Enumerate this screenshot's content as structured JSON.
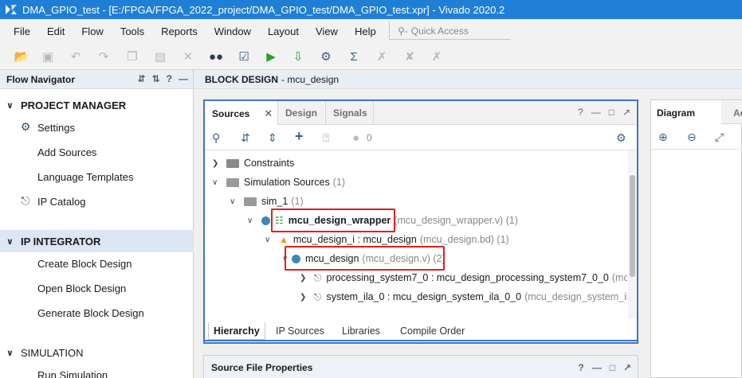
{
  "window": {
    "title": "DMA_GPIO_test - [E:/FPGA/FPGA_2022_project/DMA_GPIO_test/DMA_GPIO_test.xpr] - Vivado 2020.2",
    "accent": "#1f7fd6"
  },
  "menu": {
    "items": [
      "File",
      "Edit",
      "Flow",
      "Tools",
      "Reports",
      "Window",
      "Layout",
      "View",
      "Help"
    ],
    "quick_access": "Quick Access"
  },
  "toolbar": {
    "icons": [
      "open-project-icon",
      "save-icon",
      "undo-icon",
      "redo-icon",
      "copy-icon",
      "paste-icon",
      "delete-icon",
      "binoculars-icon",
      "check-icon",
      "run-icon",
      "program-icon",
      "settings-icon",
      "sigma-icon",
      "disabled-tool-icon",
      "disabled-tool-icon",
      "disabled-tool-icon"
    ]
  },
  "flow_navigator": {
    "title": "Flow Navigator",
    "project_manager": {
      "label": "PROJECT MANAGER",
      "items": [
        "Settings",
        "Add Sources",
        "Language Templates",
        "IP Catalog"
      ]
    },
    "ip_integrator": {
      "label": "IP INTEGRATOR",
      "items": [
        "Create Block Design",
        "Open Block Design",
        "Generate Block Design"
      ]
    },
    "simulation": {
      "label": "SIMULATION",
      "items": [
        "Run Simulation"
      ]
    }
  },
  "block_design": {
    "label": "BLOCK DESIGN",
    "name": "- mcu_design"
  },
  "sources": {
    "tabs": [
      "Sources",
      "Design",
      "Signals"
    ],
    "badge_count": "0",
    "tree": {
      "constraints": "Constraints",
      "simulation_sources": "Simulation Sources",
      "simulation_sources_count": "(1)",
      "sim_1": "sim_1",
      "sim_1_count": "(1)",
      "wrapper": "mcu_design_wrapper",
      "wrapper_detail": "(mcu_design_wrapper.v) (1)",
      "design_i": "mcu_design_i : mcu_design",
      "design_i_detail": "(mcu_design.bd) (1)",
      "mcu_design": "mcu_design",
      "mcu_design_detail": "(mcu_design.v) (2)",
      "ps7": "processing_system7_0 : mcu_design_processing_system7_0_0",
      "ps7_detail": "(mcu",
      "ila": "system_ila_0 : mcu_design_system_ila_0_0",
      "ila_detail": "(mcu_design_system_ila"
    },
    "bottom_tabs": [
      "Hierarchy",
      "IP Sources",
      "Libraries",
      "Compile Order"
    ],
    "highlight_color": "#e0201c"
  },
  "source_file_properties": "Source File Properties",
  "diagram": {
    "tab": "Diagram",
    "tab2": "Ad"
  }
}
